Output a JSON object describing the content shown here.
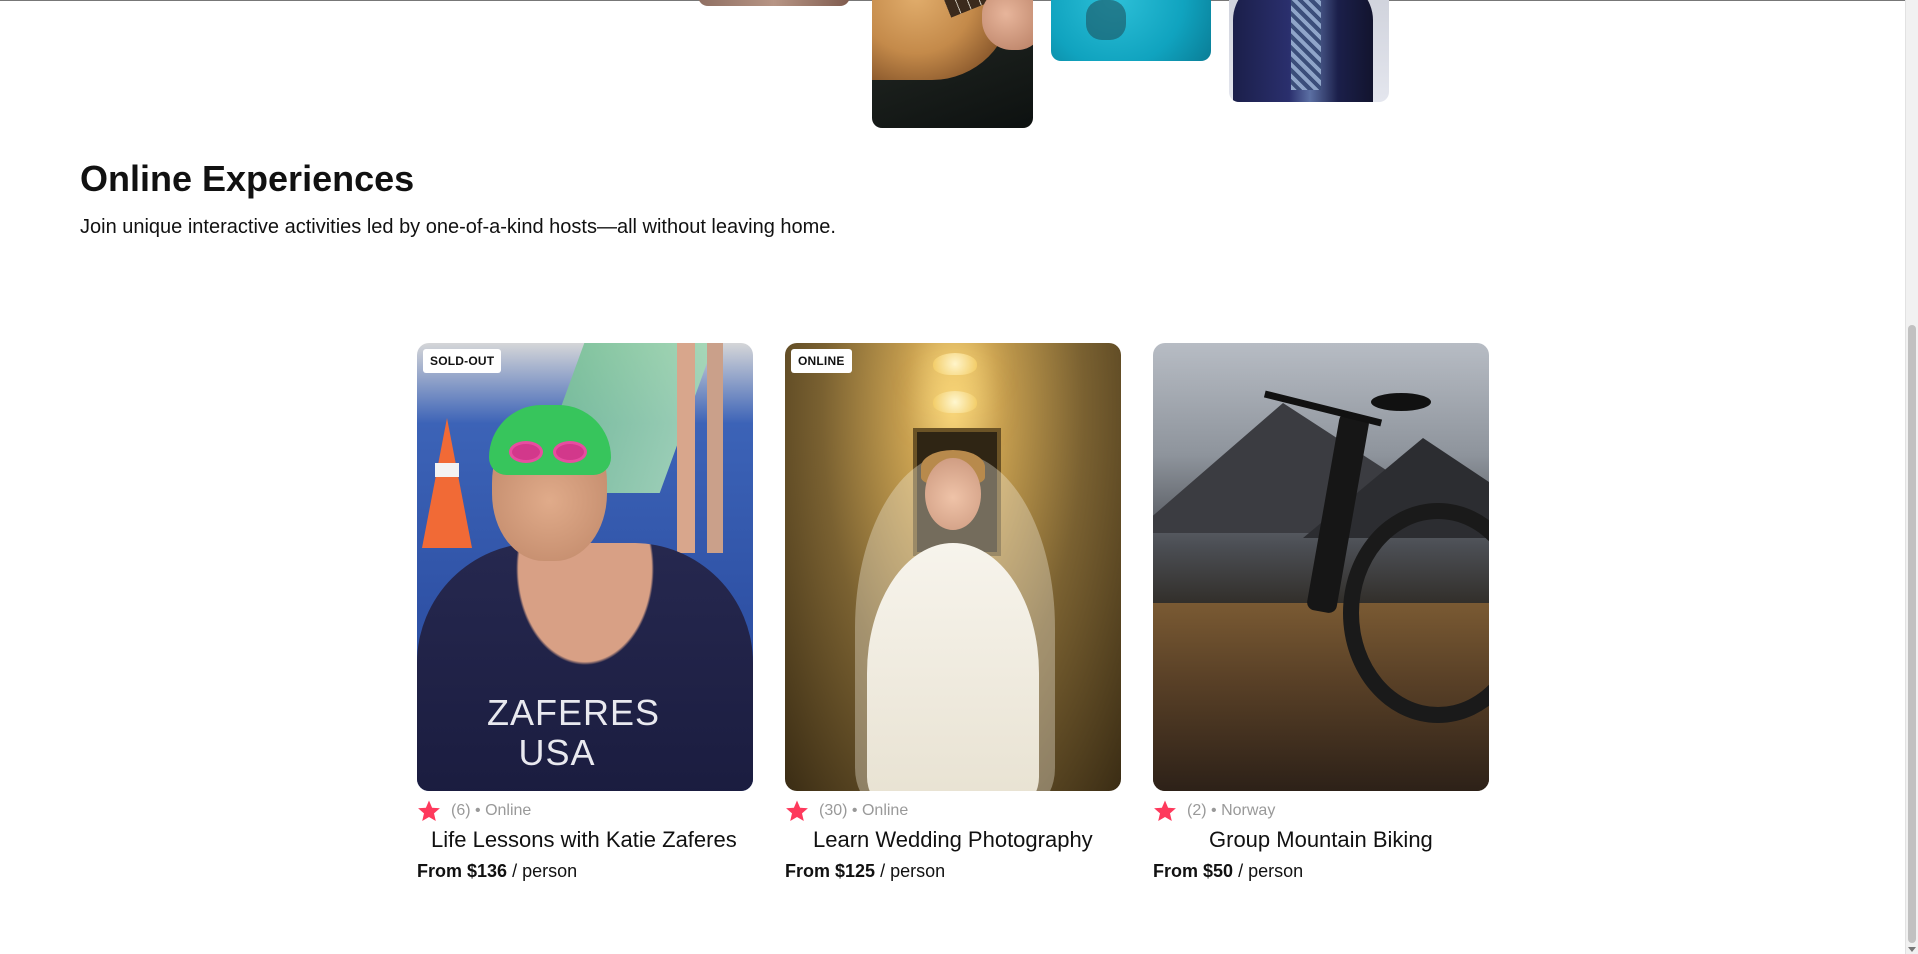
{
  "section": {
    "title": "Online Experiences",
    "subtitle": "Join unique interactive activities led by one-of-a-kind hosts—all without leaving home."
  },
  "colors": {
    "star": "#fe395c",
    "muted": "#999999",
    "text": "#111111"
  },
  "cards": [
    {
      "badge": "SOLD-OUT",
      "rating_count": "(6)",
      "separator": "•",
      "location": "Online",
      "title": "Life Lessons with Katie Zaferes",
      "price_from": "From $136",
      "price_unit": "/ person",
      "suit_text_1": "ZAFERES",
      "suit_text_2": "USA"
    },
    {
      "badge": "ONLINE",
      "rating_count": "(30)",
      "separator": "•",
      "location": "Online",
      "title": "Learn Wedding Photography",
      "price_from": "From $125",
      "price_unit": "/ person"
    },
    {
      "badge": "",
      "rating_count": "(2)",
      "separator": "•",
      "location": "Norway",
      "title": "Group Mountain Biking",
      "price_from": "From $50",
      "price_unit": "/ person"
    }
  ],
  "icons": {
    "rating": "star-icon"
  }
}
